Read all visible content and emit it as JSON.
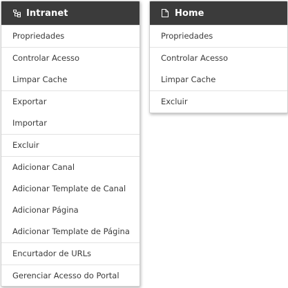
{
  "menus": [
    {
      "title": "Intranet",
      "icon": "sitemap-icon",
      "groups": [
        [
          "Propriedades"
        ],
        [
          "Controlar Acesso",
          "Limpar Cache"
        ],
        [
          "Exportar",
          "Importar"
        ],
        [
          "Excluir"
        ],
        [
          "Adicionar Canal",
          "Adicionar Template de Canal",
          "Adicionar Página",
          "Adicionar Template de Página"
        ],
        [
          "Encurtador de URLs"
        ],
        [
          "Gerenciar Acesso do Portal"
        ]
      ]
    },
    {
      "title": "Home",
      "icon": "page-icon",
      "groups": [
        [
          "Propriedades"
        ],
        [
          "Controlar Acesso",
          "Limpar Cache"
        ],
        [
          "Excluir"
        ]
      ]
    }
  ],
  "colors": {
    "header_bg": "#3b3b3b",
    "header_text": "#ffffff",
    "item_text": "#3a3a3a",
    "divider": "#e2e2e2"
  }
}
